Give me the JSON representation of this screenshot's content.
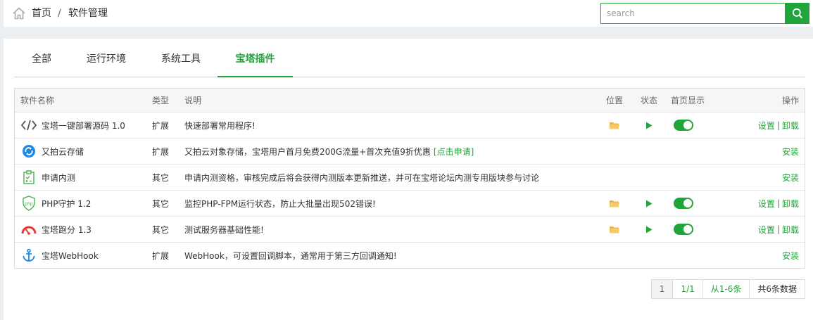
{
  "breadcrumb": {
    "home": "首页",
    "sep": "/",
    "current": "软件管理"
  },
  "search": {
    "placeholder": "search"
  },
  "tabs": [
    {
      "label": "全部"
    },
    {
      "label": "运行环境"
    },
    {
      "label": "系统工具"
    },
    {
      "label": "宝塔插件"
    }
  ],
  "table": {
    "headers": {
      "name": "软件名称",
      "type": "类型",
      "desc": "说明",
      "location": "位置",
      "status": "状态",
      "home": "首页显示",
      "ops": "操作"
    },
    "rows": [
      {
        "name": "宝塔一键部署源码 1.0",
        "type": "扩展",
        "desc": "快速部署常用程序!",
        "icon": "code-icon",
        "installed": true,
        "op1": "设置",
        "sep": "|",
        "op2": "卸载"
      },
      {
        "name": "又拍云存储",
        "type": "扩展",
        "desc": "又拍云对象存储，宝塔用户首月免费200G流量+首次充值9折优惠",
        "desc_link": "[点击申请]",
        "icon": "upyun-icon",
        "installed": false,
        "op1": "安装"
      },
      {
        "name": "申请内测",
        "type": "其它",
        "desc": "申请内测资格，审核完成后将会获得内测版本更新推送，并可在宝塔论坛内测专用版块参与讨论",
        "icon": "clipboard-icon",
        "installed": false,
        "op1": "安装"
      },
      {
        "name": "PHP守护 1.2",
        "type": "其它",
        "desc": "监控PHP-FPM运行状态，防止大批量出现502错误!",
        "icon": "php-shield-icon",
        "installed": true,
        "op1": "设置",
        "sep": "|",
        "op2": "卸载"
      },
      {
        "name": "宝塔跑分 1.3",
        "type": "其它",
        "desc": "测试服务器基础性能!",
        "icon": "gauge-icon",
        "installed": true,
        "op1": "设置",
        "sep": "|",
        "op2": "卸载"
      },
      {
        "name": "宝塔WebHook",
        "type": "扩展",
        "desc": "WebHook，可设置回调脚本，通常用于第三方回调通知!",
        "icon": "anchor-icon",
        "installed": false,
        "op1": "安装"
      }
    ]
  },
  "pager": {
    "current": "1",
    "pages": "1/1",
    "range": "从1-6条",
    "total": "共6条数据"
  },
  "colors": {
    "accent": "#20a53a",
    "folder": "#e8b64a"
  }
}
